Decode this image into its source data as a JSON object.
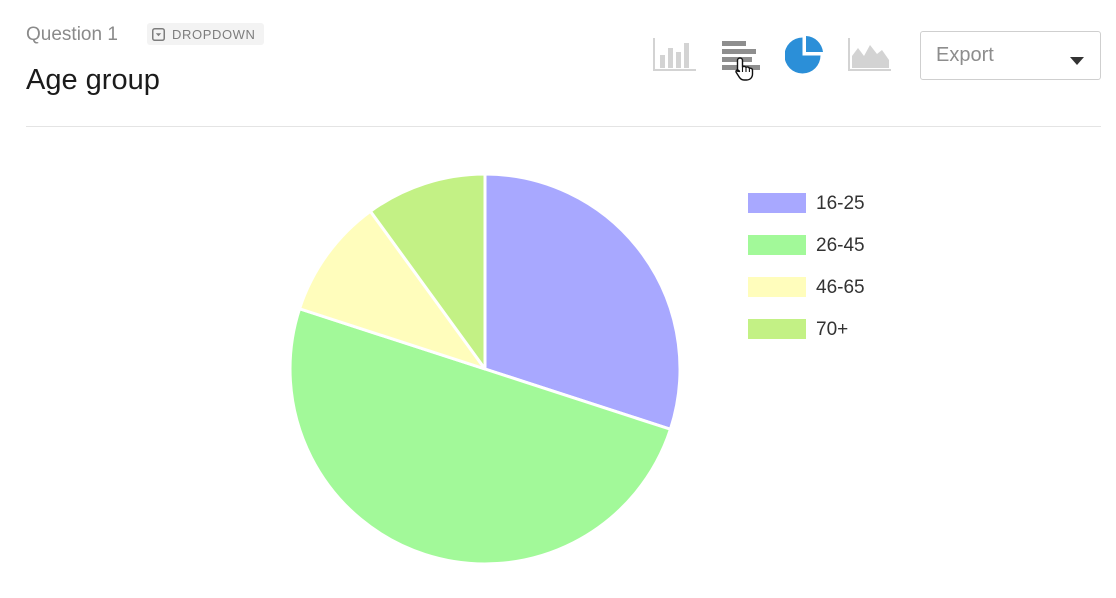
{
  "header": {
    "question_label": "Question 1",
    "type_badge": "DROPDOWN",
    "title": "Age group"
  },
  "chart_switcher": [
    {
      "name": "bar-chart-icon",
      "active": false
    },
    {
      "name": "horizontal-bar-chart-icon",
      "active": false
    },
    {
      "name": "pie-chart-icon",
      "active": true
    },
    {
      "name": "area-chart-icon",
      "active": false
    }
  ],
  "export": {
    "label": "Export"
  },
  "colors": {
    "active_icon": "#2b8fd8",
    "inactive_icon": "#d3d3d3",
    "hover_icon": "#8e8e8e"
  },
  "chart_data": {
    "type": "pie",
    "categories": [
      "16-25",
      "26-45",
      "46-65",
      "70+"
    ],
    "values": [
      30,
      50,
      10,
      10
    ],
    "colors": [
      "#a8a8ff",
      "#a2f999",
      "#fffdbc",
      "#c3f185"
    ],
    "legend_position": "right"
  }
}
